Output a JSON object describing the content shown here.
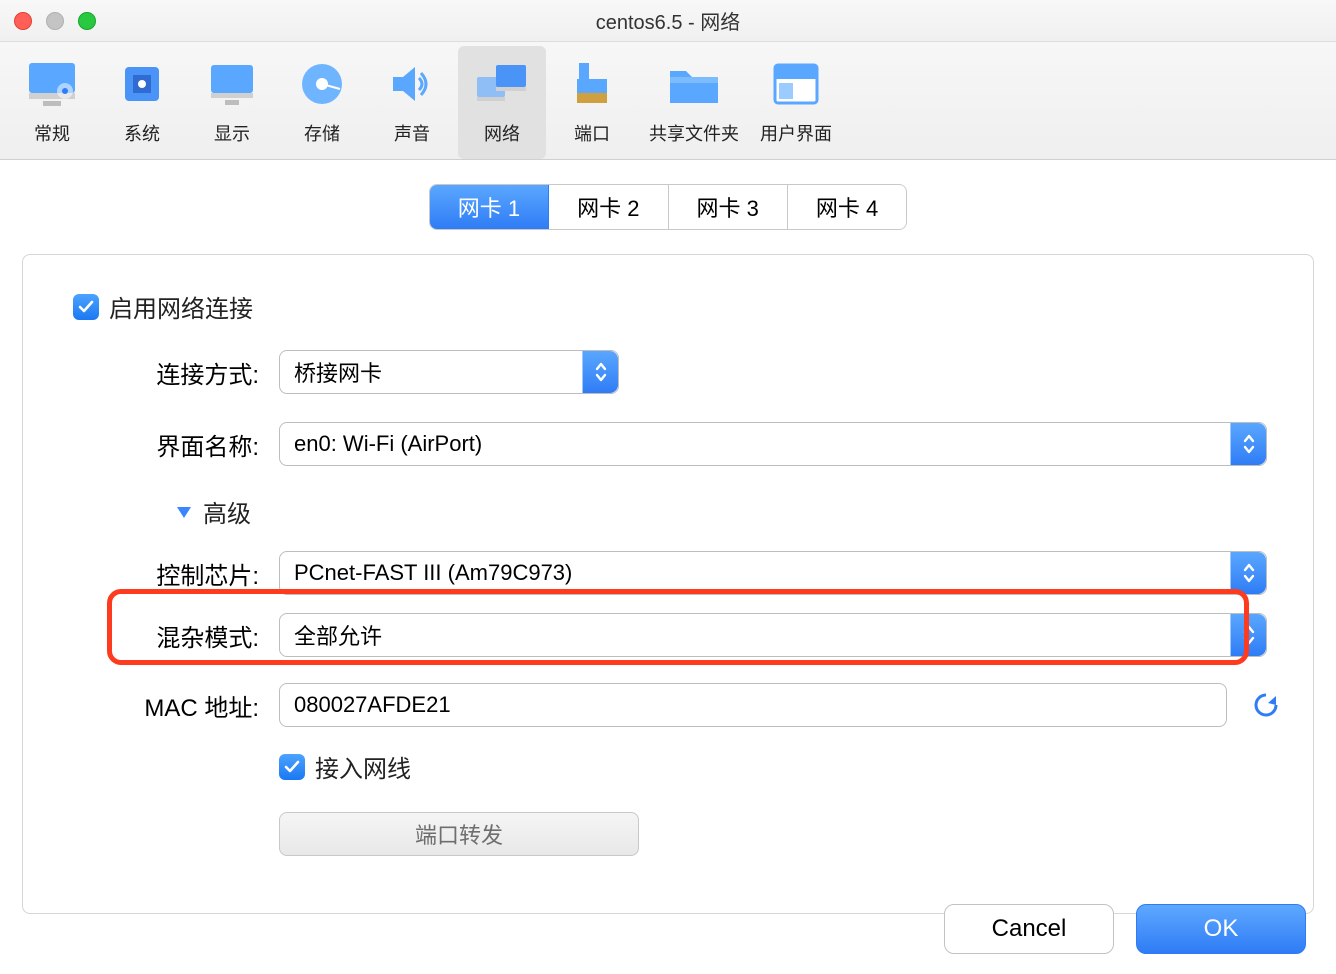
{
  "window": {
    "title": "centos6.5 - 网络"
  },
  "toolbar": {
    "items": [
      {
        "label": "常规",
        "icon": "monitor-settings"
      },
      {
        "label": "系统",
        "icon": "chip"
      },
      {
        "label": "显示",
        "icon": "monitor"
      },
      {
        "label": "存储",
        "icon": "disk"
      },
      {
        "label": "声音",
        "icon": "speaker"
      },
      {
        "label": "网络",
        "icon": "network",
        "selected": true
      },
      {
        "label": "端口",
        "icon": "usb-port"
      },
      {
        "label": "共享文件夹",
        "icon": "folder"
      },
      {
        "label": "用户界面",
        "icon": "window-ui"
      }
    ]
  },
  "tabs": {
    "items": [
      {
        "label": "网卡 1",
        "active": true
      },
      {
        "label": "网卡 2"
      },
      {
        "label": "网卡 3"
      },
      {
        "label": "网卡 4"
      }
    ]
  },
  "form": {
    "enable_label": "启用网络连接",
    "enable_checked": true,
    "attach_label": "连接方式:",
    "attach_value": "桥接网卡",
    "iface_label": "界面名称:",
    "iface_value": "en0: Wi-Fi (AirPort)",
    "advanced_label": "高级",
    "adapter_label": "控制芯片:",
    "adapter_value": "PCnet-FAST III (Am79C973)",
    "promiscuous_label": "混杂模式:",
    "promiscuous_value": "全部允许",
    "mac_label": "MAC 地址:",
    "mac_value": "080027AFDE21",
    "cable_label": "接入网线",
    "cable_checked": true,
    "port_forward_label": "端口转发"
  },
  "footer": {
    "cancel": "Cancel",
    "ok": "OK"
  },
  "colors": {
    "accent": "#2f7cf6",
    "highlight": "#ff3b1f"
  }
}
